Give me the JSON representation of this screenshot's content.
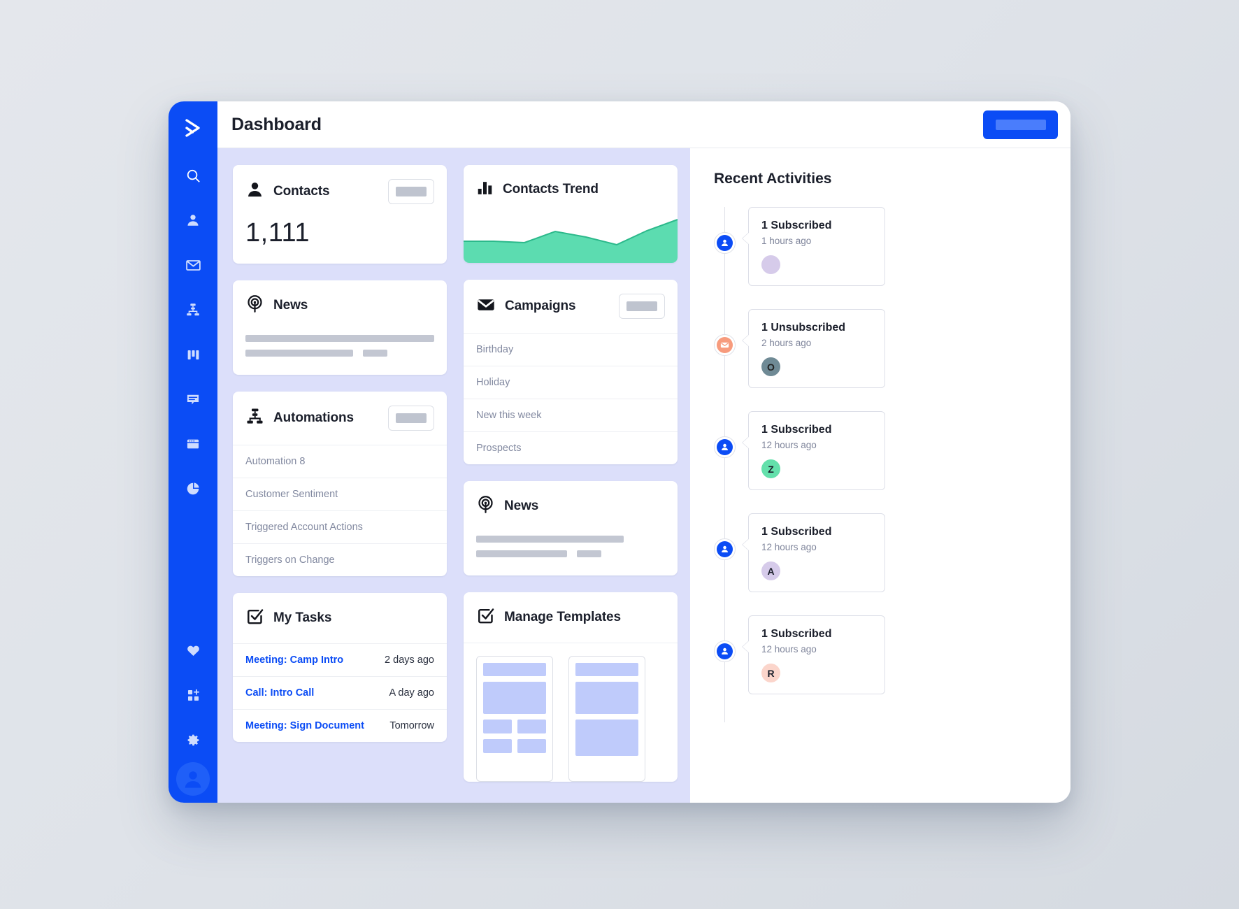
{
  "theme": {
    "brand_blue": "#0b4cf5",
    "panel_lavender": "#dcdffa",
    "trend_green": "#5cdcb0",
    "muted_text": "#8289a0"
  },
  "header": {
    "title": "Dashboard",
    "primary_button_label": ""
  },
  "sidebar": {
    "logo_icon": "activecampaign-chevron-logo",
    "items": [
      {
        "icon": "search-icon",
        "name": "search"
      },
      {
        "icon": "person-icon",
        "name": "contacts"
      },
      {
        "icon": "envelope-icon",
        "name": "campaigns"
      },
      {
        "icon": "automation-flow-icon",
        "name": "automations"
      },
      {
        "icon": "columns-icon",
        "name": "deals"
      },
      {
        "icon": "chat-bubble-icon",
        "name": "conversations"
      },
      {
        "icon": "website-window-icon",
        "name": "website"
      },
      {
        "icon": "pie-chart-icon",
        "name": "reports"
      }
    ],
    "bottom_items": [
      {
        "icon": "heart-icon",
        "name": "favorites"
      },
      {
        "icon": "apps-add-icon",
        "name": "apps"
      },
      {
        "icon": "gear-icon",
        "name": "settings"
      }
    ],
    "avatar_icon": "user-avatar-icon"
  },
  "cards": {
    "contacts": {
      "icon": "person-icon",
      "title": "Contacts",
      "button_label": "",
      "value": "1,111"
    },
    "news_left": {
      "icon": "broadcast-icon",
      "title": "News"
    },
    "automations": {
      "icon": "automation-flow-icon",
      "title": "Automations",
      "button_label": "",
      "items": [
        "Automation 8",
        "Customer Sentiment",
        "Triggered Account Actions",
        "Triggers on Change"
      ]
    },
    "my_tasks": {
      "icon": "checkbox-check-icon",
      "title": "My Tasks",
      "rows": [
        {
          "name": "Meeting: Camp Intro",
          "when": "2 days ago"
        },
        {
          "name": "Call: Intro Call",
          "when": "A day ago"
        },
        {
          "name": "Meeting: Sign Document",
          "when": "Tomorrow"
        }
      ]
    },
    "contacts_trend": {
      "icon": "bar-chart-icon",
      "title": "Contacts Trend"
    },
    "campaigns": {
      "icon": "envelope-icon",
      "title": "Campaigns",
      "button_label": "",
      "items": [
        "Birthday",
        "Holiday",
        "New this week",
        "Prospects"
      ]
    },
    "news_middle": {
      "icon": "broadcast-icon",
      "title": "News"
    },
    "manage_templates": {
      "icon": "checkbox-check-icon",
      "title": "Manage Templates",
      "thumbnails": [
        "template-thumbnail-1",
        "template-thumbnail-2"
      ]
    }
  },
  "chart_data": {
    "type": "area",
    "title": "Contacts Trend",
    "x": [
      0,
      1,
      2,
      3,
      4,
      5,
      6,
      7
    ],
    "values": [
      44,
      44,
      43,
      58,
      68,
      52,
      40,
      88
    ],
    "series": [
      {
        "name": "Contacts",
        "values": [
          44,
          44,
          43,
          58,
          68,
          52,
          40,
          88
        ]
      }
    ],
    "xlabel": "",
    "ylabel": "",
    "ylim": [
      0,
      100
    ],
    "grid": false,
    "legend": "none",
    "fill_color": "#5cdcb0",
    "line_color": "#2cb98b"
  },
  "activities": {
    "heading": "Recent Activities",
    "items": [
      {
        "icon": "subscribed-contact-icon",
        "icon_style": "blue",
        "title": "1 Subscribed",
        "time": "1 hours ago",
        "avatar_letter": "",
        "avatar_color": "#d6cbea"
      },
      {
        "icon": "unsubscribed-mail-icon",
        "icon_style": "orange",
        "title": "1 Unsubscribed",
        "time": "2 hours ago",
        "avatar_letter": "O",
        "avatar_color": "#6f8a95"
      },
      {
        "icon": "subscribed-contact-icon",
        "icon_style": "blue",
        "title": "1 Subscribed",
        "time": "12 hours ago",
        "avatar_letter": "Z",
        "avatar_color": "#63e0ab"
      },
      {
        "icon": "subscribed-contact-icon",
        "icon_style": "blue",
        "title": "1 Subscribed",
        "time": "12 hours ago",
        "avatar_letter": "A",
        "avatar_color": "#d6cbea"
      },
      {
        "icon": "subscribed-contact-icon",
        "icon_style": "blue",
        "title": "1 Subscribed",
        "time": "12 hours ago",
        "avatar_letter": "R",
        "avatar_color": "#fbd5cb"
      }
    ]
  }
}
